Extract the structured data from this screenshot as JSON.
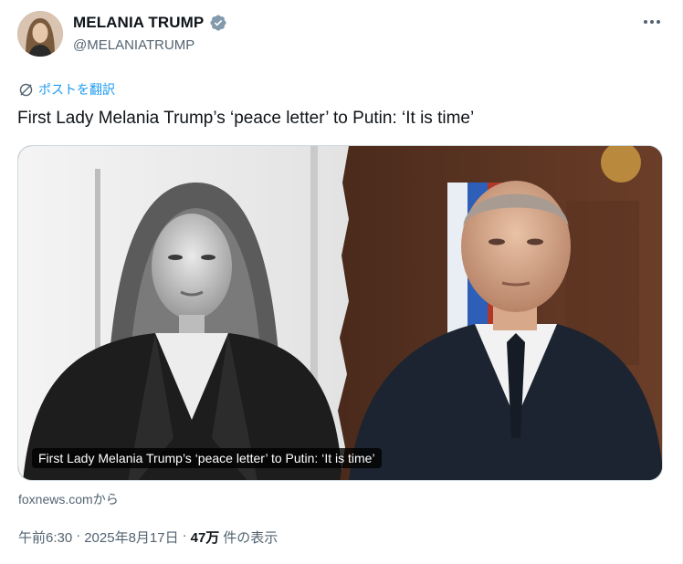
{
  "author": {
    "display_name": "MELANIA TRUMP",
    "handle": "@MELANIATRUMP",
    "verified": true
  },
  "icons": {
    "avatar": "avatar",
    "verified": "verified-badge-icon",
    "more": "more-icon",
    "translate": "translate-icon"
  },
  "translate_label": "ポストを翻訳",
  "tweet_text": "First Lady Melania Trump’s ‘peace letter’ to Putin: ‘It is time’",
  "card": {
    "headline": "First Lady Melania Trump’s ‘peace letter’ to Putin: ‘It is time’",
    "source": "foxnews.comから"
  },
  "meta": {
    "time": "午前6:30",
    "sep1": "·",
    "date": "2025年8月17日",
    "sep2": "·",
    "views": "47万",
    "views_label": "件の表示"
  },
  "colors": {
    "accent": "#1d9bf0",
    "text": "#0f1419",
    "secondary": "#536471",
    "verified_badge": "#829aab"
  }
}
